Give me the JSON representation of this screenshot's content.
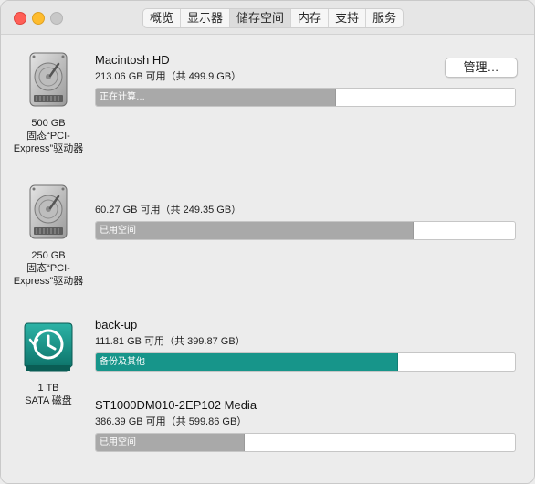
{
  "tabs": [
    {
      "label": "概览"
    },
    {
      "label": "显示器"
    },
    {
      "label": "储存空间"
    },
    {
      "label": "内存"
    },
    {
      "label": "支持"
    },
    {
      "label": "服务"
    }
  ],
  "selected_tab": "储存空间",
  "manage_label": "管理…",
  "drives": [
    {
      "caption": [
        "500 GB",
        "固态“PCI-",
        "Express”驱动器"
      ],
      "volumes": [
        {
          "name": "Macintosh HD",
          "subtitle": "213.06 GB 可用（共 499.9 GB）",
          "bar_label": "正在计算…",
          "used_fraction": 0.5737
        }
      ]
    },
    {
      "caption": [
        "250 GB",
        "固态“PCI-",
        "Express”驱动器"
      ],
      "volumes": [
        {
          "name": "",
          "subtitle": "60.27 GB 可用（共 249.35 GB）",
          "bar_label": "已用空间",
          "used_fraction": 0.7583
        }
      ]
    },
    {
      "caption": [
        "1 TB",
        "SATA 磁盘"
      ],
      "volumes": [
        {
          "name": "back-up",
          "subtitle": "111.81 GB 可用（共 399.87 GB）",
          "bar_label": "备份及其他",
          "used_fraction": 0.7204
        },
        {
          "name": "ST1000DM010-2EP102 Media",
          "subtitle": "386.39 GB 可用（共 599.86 GB）",
          "bar_label": "已用空间",
          "used_fraction": 0.3559
        }
      ]
    }
  ],
  "colors": {
    "used_gray": "#a9a9a9",
    "backup_teal": "#17958a",
    "traffic_close": "#ff5f57",
    "traffic_min": "#febc2e",
    "traffic_max": "#c8c8c8"
  },
  "icons": [
    "internal-drive-icon",
    "internal-drive-icon",
    "time-machine-drive-icon"
  ]
}
